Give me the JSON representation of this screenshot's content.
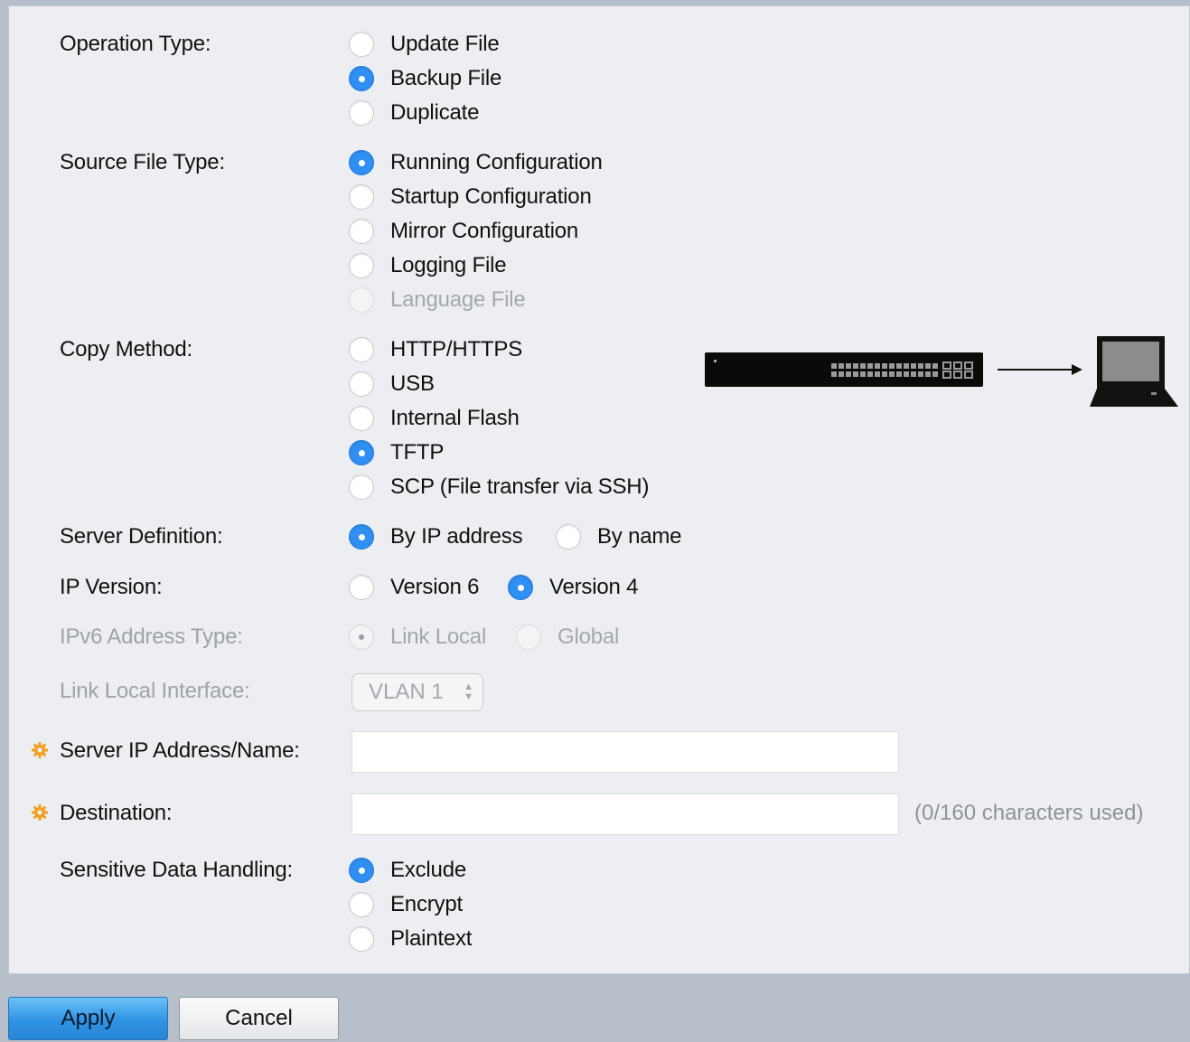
{
  "operation_type": {
    "label": "Operation Type:",
    "options": [
      "Update File",
      "Backup File",
      "Duplicate"
    ],
    "selected": "Backup File"
  },
  "source_file_type": {
    "label": "Source File Type:",
    "options": [
      "Running Configuration",
      "Startup Configuration",
      "Mirror Configuration",
      "Logging File",
      "Language File"
    ],
    "selected": "Running Configuration",
    "disabled": [
      "Language File"
    ]
  },
  "copy_method": {
    "label": "Copy Method:",
    "options": [
      "HTTP/HTTPS",
      "USB",
      "Internal Flash",
      "TFTP",
      "SCP (File transfer via SSH)"
    ],
    "selected": "TFTP"
  },
  "server_definition": {
    "label": "Server Definition:",
    "options": [
      "By IP address",
      "By name"
    ],
    "selected": "By IP address"
  },
  "ip_version": {
    "label": "IP Version:",
    "options": [
      "Version 6",
      "Version 4"
    ],
    "selected": "Version 4"
  },
  "ipv6_address_type": {
    "label": "IPv6 Address Type:",
    "options": [
      "Link Local",
      "Global"
    ],
    "selected": "Link Local",
    "disabled": true
  },
  "link_local_interface": {
    "label": "Link Local Interface:",
    "value": "VLAN 1",
    "disabled": true
  },
  "server_ip": {
    "label": "Server IP Address/Name:",
    "value": "",
    "required": true
  },
  "destination": {
    "label": "Destination:",
    "value": "",
    "required": true,
    "hint": "(0/160 characters used)"
  },
  "sensitive_data": {
    "label": "Sensitive Data Handling:",
    "options": [
      "Exclude",
      "Encrypt",
      "Plaintext"
    ],
    "selected": "Exclude"
  },
  "buttons": {
    "apply": "Apply",
    "cancel": "Cancel"
  },
  "icons": {
    "required": "gear-icon",
    "diagram_source": "switch-icon",
    "diagram_arrow": "arrow-right-icon",
    "diagram_target": "laptop-icon"
  },
  "colors": {
    "radio_checked": "#2f8ff2",
    "required_icon": "#f0a020",
    "apply_button": "#2e93e3"
  }
}
